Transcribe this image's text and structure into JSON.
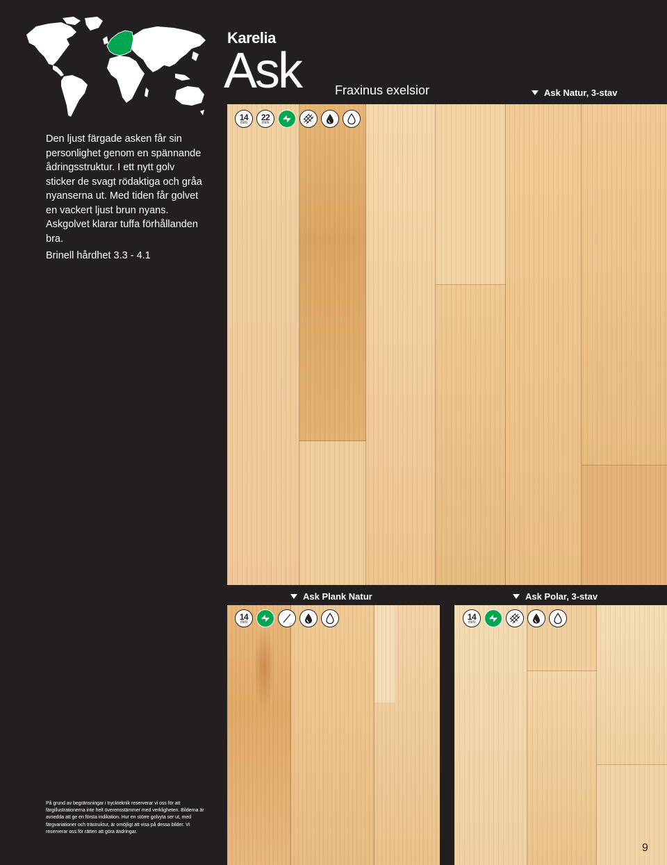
{
  "header": {
    "brand": "Karelia",
    "species": "Ask",
    "latin_name": "Fraxinus exelsior"
  },
  "intro_text": "Den ljust färgade asken får sin personlighet genom en spännande ådringsstruktur. I ett nytt golv sticker de svagt rödaktiga och gråa nyanserna ut. Med tiden får golvet en vackert ljust brun nyans. Askgolvet klarar tuffa förhållanden bra.",
  "brinell": "Brinell hårdhet  3.3 - 4.1",
  "products": [
    {
      "caption": "Ask Natur, 3-stav",
      "badges": [
        {
          "type": "thickness",
          "value": "14",
          "unit": "mm"
        },
        {
          "type": "thickness",
          "value": "22",
          "unit": "mm"
        },
        {
          "type": "icon",
          "icon": "floating-install-icon"
        },
        {
          "type": "icon",
          "icon": "parquet-pattern-icon"
        },
        {
          "type": "icon",
          "icon": "oil-drop-icon"
        },
        {
          "type": "icon",
          "icon": "lacquer-drop-icon"
        }
      ]
    },
    {
      "caption": "Ask Plank Natur",
      "badges": [
        {
          "type": "thickness",
          "value": "14",
          "unit": "mm"
        },
        {
          "type": "icon",
          "icon": "floating-install-icon"
        },
        {
          "type": "icon",
          "icon": "plank-pattern-icon"
        },
        {
          "type": "icon",
          "icon": "oil-drop-icon"
        },
        {
          "type": "icon",
          "icon": "lacquer-drop-icon"
        }
      ]
    },
    {
      "caption": "Ask Polar, 3-stav",
      "badges": [
        {
          "type": "thickness",
          "value": "14",
          "unit": "mm"
        },
        {
          "type": "icon",
          "icon": "floating-install-icon"
        },
        {
          "type": "icon",
          "icon": "parquet-pattern-icon"
        },
        {
          "type": "icon",
          "icon": "oil-drop-icon"
        },
        {
          "type": "icon",
          "icon": "lacquer-drop-icon"
        }
      ]
    }
  ],
  "disclaimer": "På grund av begränsningar i tryckteknik reserverar vi oss för att färgillustrationerna inte helt överensstämmer med verkligheten. Bilderna är avsedda att ge en första indikation. Hur en större golvyta ser ut, med färgvariationer och trästruktur, är omöjligt att visa på dessa bilder. Vi reserverar oss för rätten att göra ändringar.",
  "page_number": "9",
  "colors": {
    "background": "#231f20",
    "map_land": "#ffffff",
    "map_highlight": "#00a650",
    "badge_green": "#00a650"
  }
}
